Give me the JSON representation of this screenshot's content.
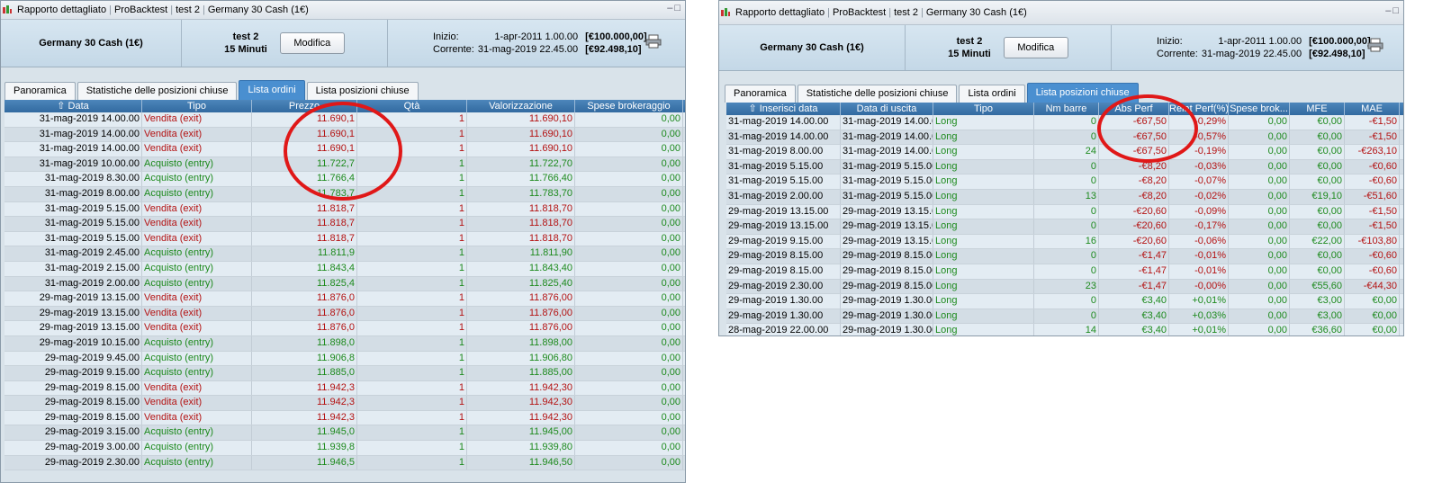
{
  "left": {
    "breadcrumbs": [
      "Rapporto dettagliato",
      "ProBacktest",
      "test 2",
      "Germany 30 Cash (1€)"
    ],
    "instrument": "Germany 30 Cash (1€)",
    "strategy_name": "test 2",
    "timeframe": "15 Minuti",
    "modify_label": "Modifica",
    "start_label": "Inizio:",
    "start_date": "1-apr-2011 1.00.00",
    "start_value": "[€100.000,00]",
    "current_label": "Corrente:",
    "current_date": "31-mag-2019 22.45.00",
    "current_value": "[€92.498,10]",
    "tabs": [
      "Panoramica",
      "Statistiche delle posizioni chiuse",
      "Lista ordini",
      "Lista posizioni chiuse"
    ],
    "active_tab": "Lista ordini",
    "columns": [
      "⇧ Data",
      "Tipo",
      "Prezzo",
      "Qtà",
      "Valorizzazione",
      "Spese brokeraggio"
    ],
    "rows": [
      [
        "31-mag-2019 14.00.00",
        "Vendita (exit)",
        "11.690,1",
        "1",
        "11.690,10",
        "0,00"
      ],
      [
        "31-mag-2019 14.00.00",
        "Vendita (exit)",
        "11.690,1",
        "1",
        "11.690,10",
        "0,00"
      ],
      [
        "31-mag-2019 14.00.00",
        "Vendita (exit)",
        "11.690,1",
        "1",
        "11.690,10",
        "0,00"
      ],
      [
        "31-mag-2019 10.00.00",
        "Acquisto (entry)",
        "11.722,7",
        "1",
        "11.722,70",
        "0,00"
      ],
      [
        "31-mag-2019 8.30.00",
        "Acquisto (entry)",
        "11.766,4",
        "1",
        "11.766,40",
        "0,00"
      ],
      [
        "31-mag-2019 8.00.00",
        "Acquisto (entry)",
        "11.783,7",
        "1",
        "11.783,70",
        "0,00"
      ],
      [
        "31-mag-2019 5.15.00",
        "Vendita (exit)",
        "11.818,7",
        "1",
        "11.818,70",
        "0,00"
      ],
      [
        "31-mag-2019 5.15.00",
        "Vendita (exit)",
        "11.818,7",
        "1",
        "11.818,70",
        "0,00"
      ],
      [
        "31-mag-2019 5.15.00",
        "Vendita (exit)",
        "11.818,7",
        "1",
        "11.818,70",
        "0,00"
      ],
      [
        "31-mag-2019 2.45.00",
        "Acquisto (entry)",
        "11.811,9",
        "1",
        "11.811,90",
        "0,00"
      ],
      [
        "31-mag-2019 2.15.00",
        "Acquisto (entry)",
        "11.843,4",
        "1",
        "11.843,40",
        "0,00"
      ],
      [
        "31-mag-2019 2.00.00",
        "Acquisto (entry)",
        "11.825,4",
        "1",
        "11.825,40",
        "0,00"
      ],
      [
        "29-mag-2019 13.15.00",
        "Vendita (exit)",
        "11.876,0",
        "1",
        "11.876,00",
        "0,00"
      ],
      [
        "29-mag-2019 13.15.00",
        "Vendita (exit)",
        "11.876,0",
        "1",
        "11.876,00",
        "0,00"
      ],
      [
        "29-mag-2019 13.15.00",
        "Vendita (exit)",
        "11.876,0",
        "1",
        "11.876,00",
        "0,00"
      ],
      [
        "29-mag-2019 10.15.00",
        "Acquisto (entry)",
        "11.898,0",
        "1",
        "11.898,00",
        "0,00"
      ],
      [
        "29-mag-2019 9.45.00",
        "Acquisto (entry)",
        "11.906,8",
        "1",
        "11.906,80",
        "0,00"
      ],
      [
        "29-mag-2019 9.15.00",
        "Acquisto (entry)",
        "11.885,0",
        "1",
        "11.885,00",
        "0,00"
      ],
      [
        "29-mag-2019 8.15.00",
        "Vendita (exit)",
        "11.942,3",
        "1",
        "11.942,30",
        "0,00"
      ],
      [
        "29-mag-2019 8.15.00",
        "Vendita (exit)",
        "11.942,3",
        "1",
        "11.942,30",
        "0,00"
      ],
      [
        "29-mag-2019 8.15.00",
        "Vendita (exit)",
        "11.942,3",
        "1",
        "11.942,30",
        "0,00"
      ],
      [
        "29-mag-2019 3.15.00",
        "Acquisto (entry)",
        "11.945,0",
        "1",
        "11.945,00",
        "0,00"
      ],
      [
        "29-mag-2019 3.00.00",
        "Acquisto (entry)",
        "11.939,8",
        "1",
        "11.939,80",
        "0,00"
      ],
      [
        "29-mag-2019 2.30.00",
        "Acquisto (entry)",
        "11.946,5",
        "1",
        "11.946,50",
        "0,00"
      ]
    ]
  },
  "right": {
    "breadcrumbs": [
      "Rapporto dettagliato",
      "ProBacktest",
      "test 2",
      "Germany 30 Cash (1€)"
    ],
    "instrument": "Germany 30 Cash (1€)",
    "strategy_name": "test 2",
    "timeframe": "15 Minuti",
    "modify_label": "Modifica",
    "start_label": "Inizio:",
    "start_date": "1-apr-2011 1.00.00",
    "start_value": "[€100.000,00]",
    "current_label": "Corrente:",
    "current_date": "31-mag-2019 22.45.00",
    "current_value": "[€92.498,10]",
    "tabs": [
      "Panoramica",
      "Statistiche delle posizioni chiuse",
      "Lista ordini",
      "Lista posizioni chiuse"
    ],
    "active_tab": "Lista posizioni chiuse",
    "columns": [
      "⇧ Inserisci data",
      "Data di uscita",
      "Tipo",
      "Nm barre",
      "Abs Perf",
      "Relat Perf(%)",
      "Spese brok...",
      "MFE",
      "MAE"
    ],
    "rows": [
      [
        "31-mag-2019 14.00.00",
        "31-mag-2019 14.00.00",
        "Long",
        "0",
        "-€67,50",
        "-0,29%",
        "0,00",
        "€0,00",
        "-€1,50"
      ],
      [
        "31-mag-2019 14.00.00",
        "31-mag-2019 14.00.00",
        "Long",
        "0",
        "-€67,50",
        "-0,57%",
        "0,00",
        "€0,00",
        "-€1,50"
      ],
      [
        "31-mag-2019 8.00.00",
        "31-mag-2019 14.00.00",
        "Long",
        "24",
        "-€67,50",
        "-0,19%",
        "0,00",
        "€0,00",
        "-€263,10"
      ],
      [
        "31-mag-2019 5.15.00",
        "31-mag-2019 5.15.00",
        "Long",
        "0",
        "-€8,20",
        "-0,03%",
        "0,00",
        "€0,00",
        "-€0,60"
      ],
      [
        "31-mag-2019 5.15.00",
        "31-mag-2019 5.15.00",
        "Long",
        "0",
        "-€8,20",
        "-0,07%",
        "0,00",
        "€0,00",
        "-€0,60"
      ],
      [
        "31-mag-2019 2.00.00",
        "31-mag-2019 5.15.00",
        "Long",
        "13",
        "-€8,20",
        "-0,02%",
        "0,00",
        "€19,10",
        "-€51,60"
      ],
      [
        "29-mag-2019 13.15.00",
        "29-mag-2019 13.15.00",
        "Long",
        "0",
        "-€20,60",
        "-0,09%",
        "0,00",
        "€0,00",
        "-€1,50"
      ],
      [
        "29-mag-2019 13.15.00",
        "29-mag-2019 13.15.00",
        "Long",
        "0",
        "-€20,60",
        "-0,17%",
        "0,00",
        "€0,00",
        "-€1,50"
      ],
      [
        "29-mag-2019 9.15.00",
        "29-mag-2019 13.15.00",
        "Long",
        "16",
        "-€20,60",
        "-0,06%",
        "0,00",
        "€22,00",
        "-€103,80"
      ],
      [
        "29-mag-2019 8.15.00",
        "29-mag-2019 8.15.00",
        "Long",
        "0",
        "-€1,47",
        "-0,01%",
        "0,00",
        "€0,00",
        "-€0,60"
      ],
      [
        "29-mag-2019 8.15.00",
        "29-mag-2019 8.15.00",
        "Long",
        "0",
        "-€1,47",
        "-0,01%",
        "0,00",
        "€0,00",
        "-€0,60"
      ],
      [
        "29-mag-2019 2.30.00",
        "29-mag-2019 8.15.00",
        "Long",
        "23",
        "-€1,47",
        "-0,00%",
        "0,00",
        "€55,60",
        "-€44,30"
      ],
      [
        "29-mag-2019 1.30.00",
        "29-mag-2019 1.30.00",
        "Long",
        "0",
        "€3,40",
        "+0,01%",
        "0,00",
        "€3,00",
        "€0,00"
      ],
      [
        "29-mag-2019 1.30.00",
        "29-mag-2019 1.30.00",
        "Long",
        "0",
        "€3,40",
        "+0,03%",
        "0,00",
        "€3,00",
        "€0,00"
      ],
      [
        "28-mag-2019 22.00.00",
        "29-mag-2019 1.30.00",
        "Long",
        "14",
        "€3,40",
        "+0,01%",
        "0,00",
        "€36,60",
        "€0,00"
      ]
    ]
  },
  "colors": {
    "sell": "#b41212",
    "buy": "#1d8a1d",
    "header": "#3a74ab",
    "active_tab": "#4a8fd0",
    "annotation": "#e01818"
  }
}
